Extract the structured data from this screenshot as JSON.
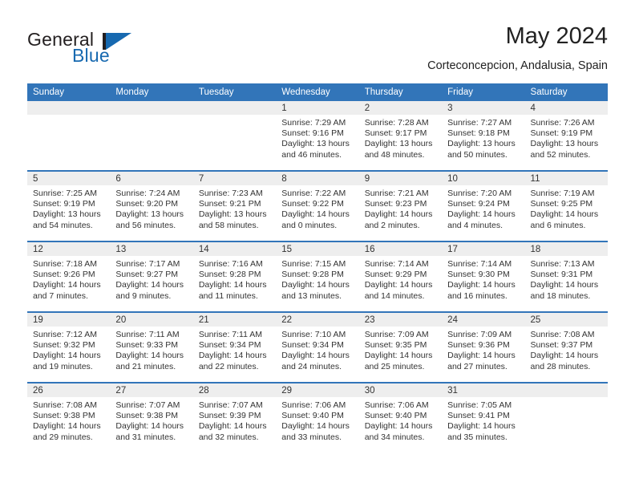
{
  "brand": {
    "name_part1": "General",
    "name_part2": "Blue",
    "accent_color": "#1769b0"
  },
  "header": {
    "title": "May 2024",
    "subtitle": "Corteconcepcion, Andalusia, Spain"
  },
  "theme": {
    "header_row_bg": "#3275b9",
    "daynum_band_bg": "#eeeeee",
    "separator_color": "#3275b9",
    "text_color": "#333333"
  },
  "weekday_headers": [
    "Sunday",
    "Monday",
    "Tuesday",
    "Wednesday",
    "Thursday",
    "Friday",
    "Saturday"
  ],
  "weeks": [
    [
      {
        "day": "",
        "sunrise": "",
        "sunset": "",
        "daylight": "",
        "empty": true
      },
      {
        "day": "",
        "sunrise": "",
        "sunset": "",
        "daylight": "",
        "empty": true
      },
      {
        "day": "",
        "sunrise": "",
        "sunset": "",
        "daylight": "",
        "empty": true
      },
      {
        "day": "1",
        "sunrise": "Sunrise: 7:29 AM",
        "sunset": "Sunset: 9:16 PM",
        "daylight": "Daylight: 13 hours and 46 minutes.",
        "empty": false
      },
      {
        "day": "2",
        "sunrise": "Sunrise: 7:28 AM",
        "sunset": "Sunset: 9:17 PM",
        "daylight": "Daylight: 13 hours and 48 minutes.",
        "empty": false
      },
      {
        "day": "3",
        "sunrise": "Sunrise: 7:27 AM",
        "sunset": "Sunset: 9:18 PM",
        "daylight": "Daylight: 13 hours and 50 minutes.",
        "empty": false
      },
      {
        "day": "4",
        "sunrise": "Sunrise: 7:26 AM",
        "sunset": "Sunset: 9:19 PM",
        "daylight": "Daylight: 13 hours and 52 minutes.",
        "empty": false
      }
    ],
    [
      {
        "day": "5",
        "sunrise": "Sunrise: 7:25 AM",
        "sunset": "Sunset: 9:19 PM",
        "daylight": "Daylight: 13 hours and 54 minutes.",
        "empty": false
      },
      {
        "day": "6",
        "sunrise": "Sunrise: 7:24 AM",
        "sunset": "Sunset: 9:20 PM",
        "daylight": "Daylight: 13 hours and 56 minutes.",
        "empty": false
      },
      {
        "day": "7",
        "sunrise": "Sunrise: 7:23 AM",
        "sunset": "Sunset: 9:21 PM",
        "daylight": "Daylight: 13 hours and 58 minutes.",
        "empty": false
      },
      {
        "day": "8",
        "sunrise": "Sunrise: 7:22 AM",
        "sunset": "Sunset: 9:22 PM",
        "daylight": "Daylight: 14 hours and 0 minutes.",
        "empty": false
      },
      {
        "day": "9",
        "sunrise": "Sunrise: 7:21 AM",
        "sunset": "Sunset: 9:23 PM",
        "daylight": "Daylight: 14 hours and 2 minutes.",
        "empty": false
      },
      {
        "day": "10",
        "sunrise": "Sunrise: 7:20 AM",
        "sunset": "Sunset: 9:24 PM",
        "daylight": "Daylight: 14 hours and 4 minutes.",
        "empty": false
      },
      {
        "day": "11",
        "sunrise": "Sunrise: 7:19 AM",
        "sunset": "Sunset: 9:25 PM",
        "daylight": "Daylight: 14 hours and 6 minutes.",
        "empty": false
      }
    ],
    [
      {
        "day": "12",
        "sunrise": "Sunrise: 7:18 AM",
        "sunset": "Sunset: 9:26 PM",
        "daylight": "Daylight: 14 hours and 7 minutes.",
        "empty": false
      },
      {
        "day": "13",
        "sunrise": "Sunrise: 7:17 AM",
        "sunset": "Sunset: 9:27 PM",
        "daylight": "Daylight: 14 hours and 9 minutes.",
        "empty": false
      },
      {
        "day": "14",
        "sunrise": "Sunrise: 7:16 AM",
        "sunset": "Sunset: 9:28 PM",
        "daylight": "Daylight: 14 hours and 11 minutes.",
        "empty": false
      },
      {
        "day": "15",
        "sunrise": "Sunrise: 7:15 AM",
        "sunset": "Sunset: 9:28 PM",
        "daylight": "Daylight: 14 hours and 13 minutes.",
        "empty": false
      },
      {
        "day": "16",
        "sunrise": "Sunrise: 7:14 AM",
        "sunset": "Sunset: 9:29 PM",
        "daylight": "Daylight: 14 hours and 14 minutes.",
        "empty": false
      },
      {
        "day": "17",
        "sunrise": "Sunrise: 7:14 AM",
        "sunset": "Sunset: 9:30 PM",
        "daylight": "Daylight: 14 hours and 16 minutes.",
        "empty": false
      },
      {
        "day": "18",
        "sunrise": "Sunrise: 7:13 AM",
        "sunset": "Sunset: 9:31 PM",
        "daylight": "Daylight: 14 hours and 18 minutes.",
        "empty": false
      }
    ],
    [
      {
        "day": "19",
        "sunrise": "Sunrise: 7:12 AM",
        "sunset": "Sunset: 9:32 PM",
        "daylight": "Daylight: 14 hours and 19 minutes.",
        "empty": false
      },
      {
        "day": "20",
        "sunrise": "Sunrise: 7:11 AM",
        "sunset": "Sunset: 9:33 PM",
        "daylight": "Daylight: 14 hours and 21 minutes.",
        "empty": false
      },
      {
        "day": "21",
        "sunrise": "Sunrise: 7:11 AM",
        "sunset": "Sunset: 9:34 PM",
        "daylight": "Daylight: 14 hours and 22 minutes.",
        "empty": false
      },
      {
        "day": "22",
        "sunrise": "Sunrise: 7:10 AM",
        "sunset": "Sunset: 9:34 PM",
        "daylight": "Daylight: 14 hours and 24 minutes.",
        "empty": false
      },
      {
        "day": "23",
        "sunrise": "Sunrise: 7:09 AM",
        "sunset": "Sunset: 9:35 PM",
        "daylight": "Daylight: 14 hours and 25 minutes.",
        "empty": false
      },
      {
        "day": "24",
        "sunrise": "Sunrise: 7:09 AM",
        "sunset": "Sunset: 9:36 PM",
        "daylight": "Daylight: 14 hours and 27 minutes.",
        "empty": false
      },
      {
        "day": "25",
        "sunrise": "Sunrise: 7:08 AM",
        "sunset": "Sunset: 9:37 PM",
        "daylight": "Daylight: 14 hours and 28 minutes.",
        "empty": false
      }
    ],
    [
      {
        "day": "26",
        "sunrise": "Sunrise: 7:08 AM",
        "sunset": "Sunset: 9:38 PM",
        "daylight": "Daylight: 14 hours and 29 minutes.",
        "empty": false
      },
      {
        "day": "27",
        "sunrise": "Sunrise: 7:07 AM",
        "sunset": "Sunset: 9:38 PM",
        "daylight": "Daylight: 14 hours and 31 minutes.",
        "empty": false
      },
      {
        "day": "28",
        "sunrise": "Sunrise: 7:07 AM",
        "sunset": "Sunset: 9:39 PM",
        "daylight": "Daylight: 14 hours and 32 minutes.",
        "empty": false
      },
      {
        "day": "29",
        "sunrise": "Sunrise: 7:06 AM",
        "sunset": "Sunset: 9:40 PM",
        "daylight": "Daylight: 14 hours and 33 minutes.",
        "empty": false
      },
      {
        "day": "30",
        "sunrise": "Sunrise: 7:06 AM",
        "sunset": "Sunset: 9:40 PM",
        "daylight": "Daylight: 14 hours and 34 minutes.",
        "empty": false
      },
      {
        "day": "31",
        "sunrise": "Sunrise: 7:05 AM",
        "sunset": "Sunset: 9:41 PM",
        "daylight": "Daylight: 14 hours and 35 minutes.",
        "empty": false
      },
      {
        "day": "",
        "sunrise": "",
        "sunset": "",
        "daylight": "",
        "empty": true
      }
    ]
  ]
}
